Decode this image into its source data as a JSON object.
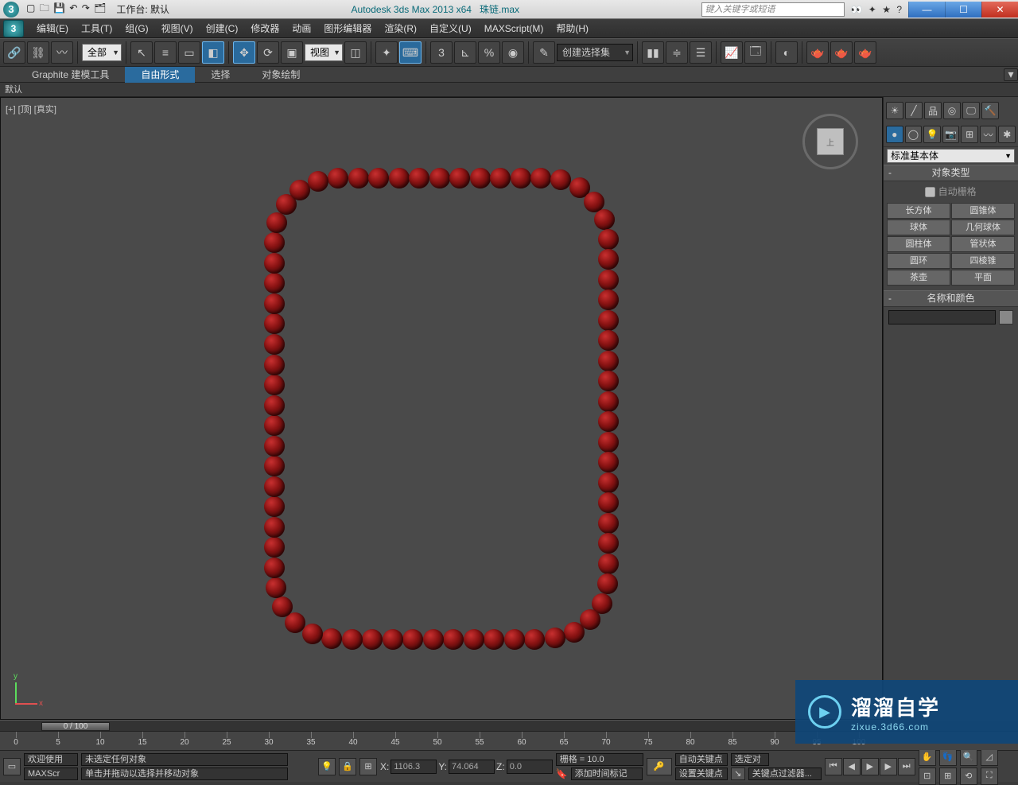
{
  "app": {
    "title": "Autodesk 3ds Max  2013 x64",
    "file": "珠链.max",
    "workbench_label": "工作台: 默认",
    "search_placeholder": "键入关键字或短语"
  },
  "menu": {
    "edit": "编辑(E)",
    "tools": "工具(T)",
    "group": "组(G)",
    "views": "视图(V)",
    "create": "创建(C)",
    "modifiers": "修改器",
    "animation": "动画",
    "graph": "图形编辑器",
    "rendering": "渲染(R)",
    "customize": "自定义(U)",
    "maxscript": "MAXScript(M)",
    "help": "帮助(H)"
  },
  "toolbar": {
    "all": "全部",
    "viewport_mode": "视图",
    "selset_placeholder": "创建选择集"
  },
  "ribbon": {
    "tabs": [
      "Graphite 建模工具",
      "自由形式",
      "选择",
      "对象绘制"
    ],
    "active": 1,
    "sub": "默认"
  },
  "viewport": {
    "label": "[+] [顶] [真实]",
    "cube": "上",
    "axis_y": "y",
    "axis_x": "x"
  },
  "panel": {
    "category": "标准基本体",
    "roll_objtype": "对象类型",
    "autogrid": "自动栅格",
    "prims": [
      "长方体",
      "圆锥体",
      "球体",
      "几何球体",
      "圆柱体",
      "管状体",
      "圆环",
      "四棱锥",
      "茶壶",
      "平面"
    ],
    "roll_name": "名称和颜色"
  },
  "timeline": {
    "slider": "0 / 100",
    "ticks": [
      0,
      5,
      10,
      15,
      20,
      25,
      30,
      35,
      40,
      45,
      50,
      55,
      60,
      65,
      70,
      75,
      80,
      85,
      90,
      95,
      100
    ]
  },
  "status": {
    "none_selected": "未选定任何对象",
    "hint": "单击并拖动以选择并移动对象",
    "x": "1106.3",
    "y": "74.064",
    "z": "0.0",
    "grid": "栅格 = 10.0",
    "addtime": "添加时间标记",
    "autokey": "自动关键点",
    "setkey": "设置关键点",
    "selonly": "选定对",
    "keyfilter": "关键点过滤器...",
    "welcome": "欢迎使用",
    "mxs": "MAXScr"
  },
  "watermark": {
    "t1": "溜溜自学",
    "t2": "zixue.3d66.com"
  }
}
